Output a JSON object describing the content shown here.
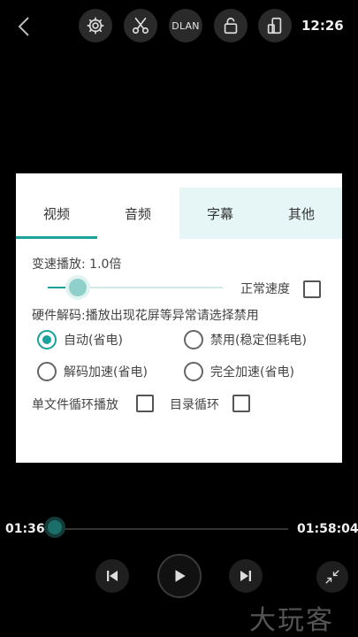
{
  "top_bar": {
    "dlan_label": "DLAN",
    "clock": "12:26",
    "icons": [
      "back-icon",
      "gear-icon",
      "scissors-icon",
      "dlan-icon",
      "unlock-icon",
      "rotate-icon"
    ]
  },
  "dialog": {
    "tabs": [
      "视频",
      "音频",
      "字幕",
      "其他"
    ],
    "active_tab": "视频",
    "speed_label": "变速播放: 1.0倍",
    "speed_value": 1.0,
    "normal_speed_label": "正常速度",
    "hw_label": "硬件解码:播放出现花屏等异常请选择禁用",
    "decode_options": [
      "自动(省电)",
      "禁用(稳定但耗电)",
      "解码加速(省电)",
      "完全加速(省电)"
    ],
    "selected_decode": "自动(省电)",
    "single_loop_label": "单文件循环播放",
    "dir_loop_label": "目录循环"
  },
  "player": {
    "current_time": "01:36",
    "total_time": "01:58:04",
    "progress_fraction": 0.014
  },
  "watermark": "大玩客",
  "colors": {
    "accent": "#1aa39a",
    "background": "#000000"
  }
}
